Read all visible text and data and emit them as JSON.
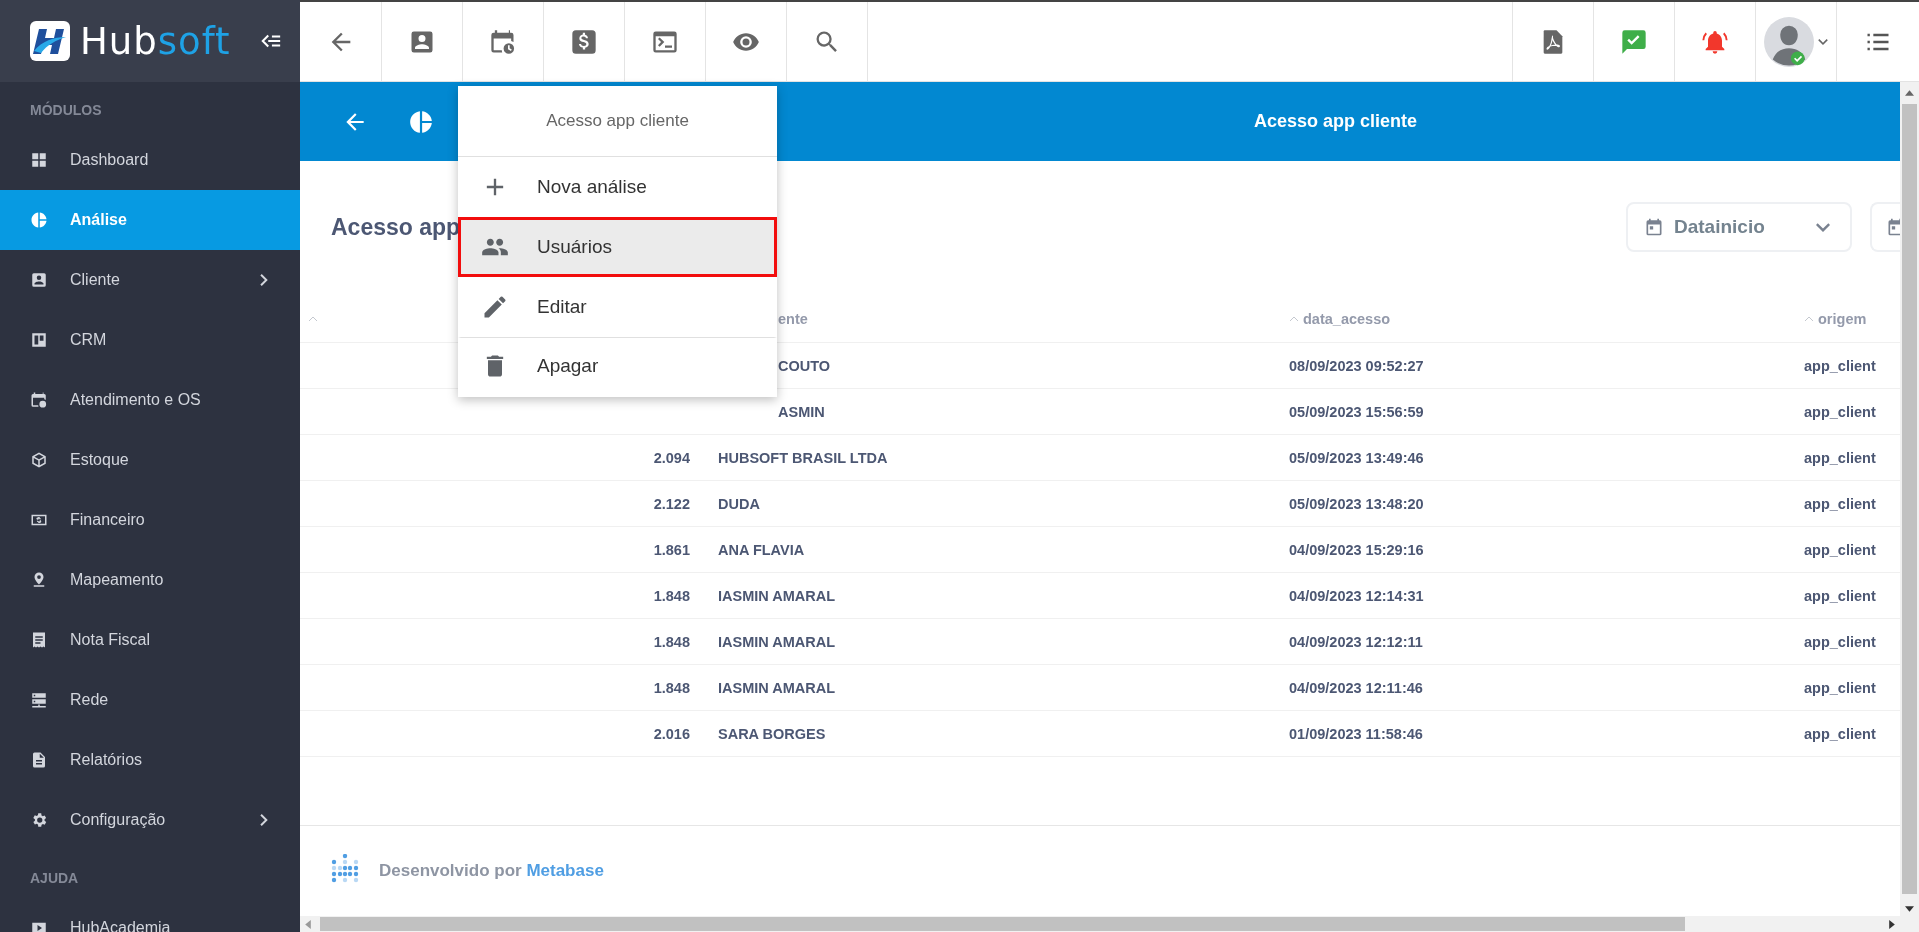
{
  "brand": "Hub**soft**",
  "sidebar": {
    "sections": [
      {
        "label": "MÓDULOS",
        "items": [
          {
            "label": "Dashboard",
            "selected": false,
            "has_submenu": false
          },
          {
            "label": "Análise",
            "selected": true,
            "has_submenu": false
          },
          {
            "label": "Cliente",
            "selected": false,
            "has_submenu": true
          },
          {
            "label": "CRM",
            "selected": false,
            "has_submenu": false
          },
          {
            "label": "Atendimento e OS",
            "selected": false,
            "has_submenu": false
          },
          {
            "label": "Estoque",
            "selected": false,
            "has_submenu": false
          },
          {
            "label": "Financeiro",
            "selected": false,
            "has_submenu": false
          },
          {
            "label": "Mapeamento",
            "selected": false,
            "has_submenu": false
          },
          {
            "label": "Nota Fiscal",
            "selected": false,
            "has_submenu": false
          },
          {
            "label": "Rede",
            "selected": false,
            "has_submenu": false
          },
          {
            "label": "Relatórios",
            "selected": false,
            "has_submenu": false
          },
          {
            "label": "Configuração",
            "selected": false,
            "has_submenu": true
          }
        ]
      },
      {
        "label": "AJUDA",
        "items": [
          {
            "label": "HubAcademia",
            "selected": false,
            "has_submenu": false
          }
        ]
      }
    ]
  },
  "header_bar": {
    "title": "Acesso app cliente"
  },
  "page_title": "Acesso app",
  "filters": [
    {
      "label": "Datainicio"
    }
  ],
  "table": {
    "columns": [
      {
        "label": "ente"
      },
      {
        "label": "data_acesso"
      },
      {
        "label": "origem"
      }
    ],
    "rows": [
      {
        "column_3": "COUTO",
        "data_acesso": "08/09/2023 09:52:27",
        "origem": "app_client"
      },
      {
        "column_3": "ASMIN",
        "data_acesso": "05/09/2023 15:56:59",
        "origem": "app_client"
      },
      {
        "column_2": "2.094",
        "column_3": "HUBSOFT BRASIL LTDA",
        "data_acesso": "05/09/2023 13:49:46",
        "origem": "app_client"
      },
      {
        "column_2": "2.122",
        "column_3": "DUDA",
        "data_acesso": "05/09/2023 13:48:20",
        "origem": "app_client"
      },
      {
        "column_2": "1.861",
        "column_3": "ANA FLAVIA",
        "data_acesso": "04/09/2023 15:29:16",
        "origem": "app_client"
      },
      {
        "column_2": "1.848",
        "column_3": "IASMIN AMARAL",
        "data_acesso": "04/09/2023 12:14:31",
        "origem": "app_client"
      },
      {
        "column_2": "1.848",
        "column_3": "IASMIN AMARAL",
        "data_acesso": "04/09/2023 12:12:11",
        "origem": "app_client"
      },
      {
        "column_2": "1.848",
        "column_3": "IASMIN AMARAL",
        "data_acesso": "04/09/2023 12:11:46",
        "origem": "app_client"
      },
      {
        "column_2": "2.016",
        "column_3": "SARA BORGES",
        "data_acesso": "01/09/2023 11:58:46",
        "origem": "app_client"
      }
    ]
  },
  "footer": {
    "text": "Desenvolvido por",
    "link": "Metabase"
  },
  "menu": {
    "title": "Acesso app cliente",
    "items": [
      {
        "kind": "add",
        "label": "Nova análise",
        "selected": false
      },
      {
        "kind": "users",
        "label": "Usuários",
        "selected": true
      },
      {
        "kind": "edit",
        "label": "Editar",
        "selected": false
      },
      {
        "kind": "delete",
        "label": "Apagar",
        "selected": false
      }
    ]
  }
}
